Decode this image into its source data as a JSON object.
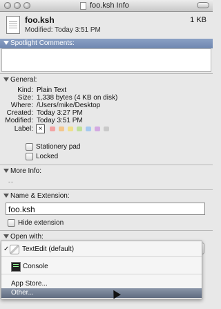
{
  "window": {
    "title": "foo.ksh Info"
  },
  "header": {
    "file_name": "foo.ksh",
    "modified": "Modified: Today 3:51 PM",
    "size": "1 KB"
  },
  "sections": {
    "spotlight": "Spotlight Comments:",
    "general": "General:",
    "more_info": "More Info:",
    "name_ext": "Name & Extension:",
    "open_with": "Open with:"
  },
  "general": {
    "rows": [
      {
        "key": "Kind:",
        "value": "Plain Text"
      },
      {
        "key": "Size:",
        "value": "1,338 bytes (4 KB on disk)"
      },
      {
        "key": "Where:",
        "value": "/Users/mike/Desktop"
      },
      {
        "key": "Created:",
        "value": "Today 3:27 PM"
      },
      {
        "key": "Modified:",
        "value": "Today 3:51 PM"
      }
    ],
    "label_key": "Label:",
    "label_clear": "×",
    "label_colors": [
      "#f2a3a3",
      "#f3c68c",
      "#f0e08a",
      "#bfe09a",
      "#a5c9ef",
      "#d3a9e2",
      "#c9c9c9"
    ],
    "stationery_pad": "Stationery pad",
    "locked": "Locked"
  },
  "more_info": {
    "placeholder": "--"
  },
  "name_ext": {
    "value": "foo.ksh",
    "hide_extension": "Hide extension"
  },
  "open_with_menu": {
    "check": "✓",
    "items": [
      "TextEdit (default)",
      "Console",
      "App Store...",
      "Other..."
    ],
    "highlighted": "Other..."
  }
}
